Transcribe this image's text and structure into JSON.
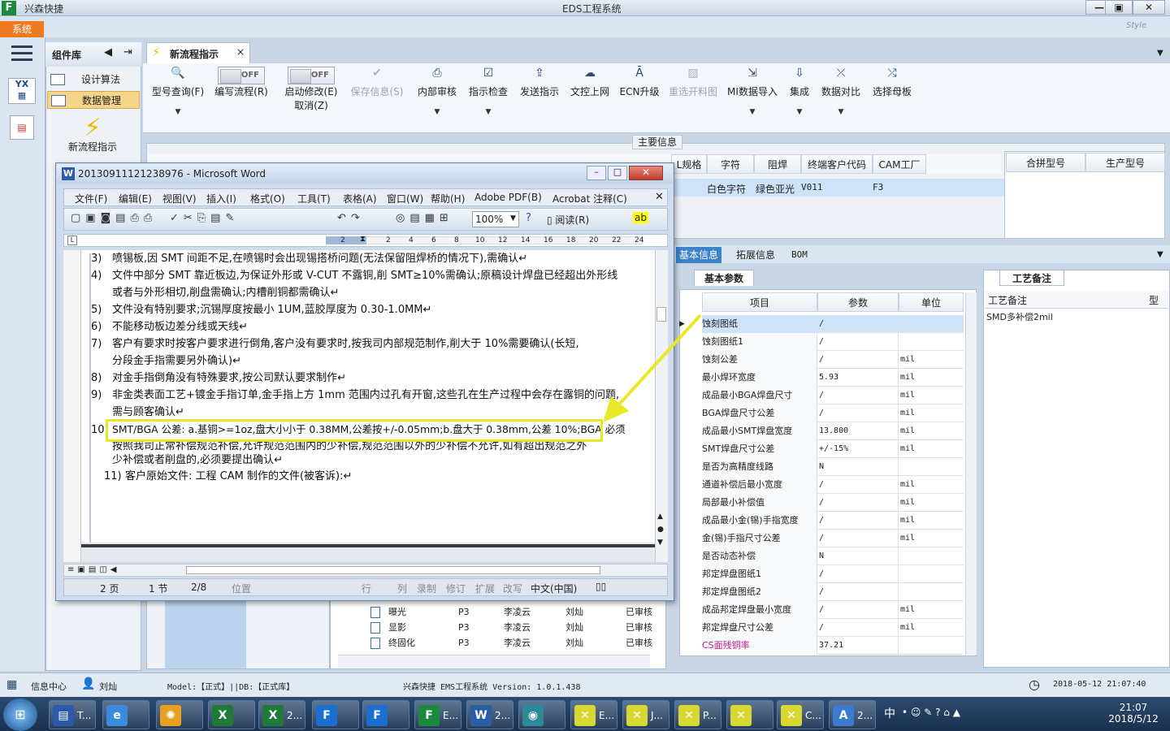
{
  "app": {
    "name": "兴森快捷",
    "window_title": "EDS工程系统",
    "style_label": "Style",
    "system_tab": "系统",
    "minimize": "—",
    "restore": "▣",
    "close": "✕"
  },
  "component_panel": {
    "title": "组件库",
    "items": [
      {
        "label": "设计算法"
      },
      {
        "label": "数据管理"
      }
    ],
    "new_flow_label": "新流程指示"
  },
  "doc_tab": {
    "label": "新流程指示",
    "close": "×"
  },
  "ribbon": {
    "buttons": [
      {
        "label": "型号查询(F)",
        "icon": "search-icon"
      },
      {
        "label": "编写流程(R)",
        "toggle": "OFF"
      },
      {
        "label": "启动修改(E)",
        "toggle": "OFF",
        "label2": "取消(Z)"
      },
      {
        "label": "保存信息(S)",
        "disabled": true
      },
      {
        "label": "内部审核"
      },
      {
        "label": "指示检查"
      },
      {
        "label": "发送指示"
      },
      {
        "label": "文控上网"
      },
      {
        "label": "ECN升级"
      },
      {
        "label": "重选开料图",
        "disabled": true
      },
      {
        "label": "MI数据导入"
      },
      {
        "label": "集成"
      },
      {
        "label": "数据对比"
      },
      {
        "label": "选择母板"
      }
    ]
  },
  "main_info": {
    "label": "主要信息",
    "headers": [
      "L规格",
      "字符",
      "阻焊",
      "终端客户代码",
      "CAM工厂"
    ],
    "row": [
      "",
      "白色字符",
      "绿色亚光",
      "V011",
      "F3"
    ],
    "right_headers": [
      "合拼型号",
      "生产型号"
    ]
  },
  "lower_tabs": [
    "基本信息",
    "拓展信息",
    "BOM"
  ],
  "basic_params": {
    "tab": "基本参数",
    "headers": [
      "项目",
      "参数",
      "单位"
    ],
    "rows": [
      [
        "蚀刻图纸",
        "/",
        ""
      ],
      [
        "蚀刻图纸1",
        "/",
        ""
      ],
      [
        "蚀刻公差",
        "/",
        "mil"
      ],
      [
        "最小焊环宽度",
        "5.93",
        "mil"
      ],
      [
        "成品最小BGA焊盘尺寸",
        "/",
        "mil"
      ],
      [
        "BGA焊盘尺寸公差",
        "/",
        "mil"
      ],
      [
        "成品最小SMT焊盘宽度",
        "13.800",
        "mil"
      ],
      [
        "SMT焊盘尺寸公差",
        "+/-15%",
        "mil"
      ],
      [
        "是否为高精度线路",
        "N",
        ""
      ],
      [
        "通道补偿后最小宽度",
        "/",
        "mil"
      ],
      [
        "局部最小补偿值",
        "/",
        "mil"
      ],
      [
        "成品最小金(锡)手指宽度",
        "/",
        "mil"
      ],
      [
        "金(锡)手指尺寸公差",
        "/",
        "mil"
      ],
      [
        "是否动态补偿",
        "N",
        ""
      ],
      [
        "邦定焊盘图纸1",
        "/",
        ""
      ],
      [
        "邦定焊盘图纸2",
        "/",
        ""
      ],
      [
        "成品邦定焊盘最小宽度",
        "/",
        "mil"
      ],
      [
        "邦定焊盘尺寸公差",
        "/",
        "mil"
      ],
      [
        "CS面残铜率",
        "37.21",
        ""
      ]
    ]
  },
  "process_notes": {
    "tab": "工艺备注",
    "header": "工艺备注",
    "header2": "型",
    "note": "SMD多补偿2mil"
  },
  "tree": {
    "rows": [
      {
        "name": "曝光",
        "f": "P3",
        "p1": "李凌云",
        "p2": "刘灿",
        "s": "已审核"
      },
      {
        "name": "显影",
        "f": "P3",
        "p1": "李凌云",
        "p2": "刘灿",
        "s": "已审核"
      },
      {
        "name": "终固化",
        "f": "P3",
        "p1": "李凌云",
        "p2": "刘灿",
        "s": "已审核"
      }
    ]
  },
  "statusbar": {
    "info_center": "信息中心",
    "user": "刘灿",
    "model": "Model:【正式】||DB:【正式库】",
    "version": "兴森快捷 EMS工程系统 Version: 1.0.1.438",
    "datetime": "2018-05-12 21:07:40"
  },
  "word": {
    "title": "20130911121238976 - Microsoft Word",
    "menu": [
      "文件(F)",
      "编辑(E)",
      "视图(V)",
      "插入(I)",
      "格式(O)",
      "工具(T)",
      "表格(A)",
      "窗口(W)",
      "帮助(H)",
      "Adobe PDF(B)",
      "Acrobat 注释(C)"
    ],
    "zoom": "100%",
    "read_label": "阅读(R)",
    "ruler": [
      "2",
      "2",
      "4",
      "6",
      "8",
      "10",
      "12",
      "14",
      "16",
      "18",
      "20",
      "22",
      "24"
    ],
    "lines": [
      {
        "n": "3)",
        "t": "喷锡板,因 SMT 间距不足,在喷锡时会出现锡搭桥问题(无法保留阻焊桥的情况下),需确认↵"
      },
      {
        "n": "4)",
        "t": "文件中部分 SMT 靠近板边,为保证外形或 V-CUT 不露铜,削 SMT≥10%需确认;原稿设计焊盘已经超出外形线"
      },
      {
        "n": "",
        "t": "或者与外形相切,削盘需确认;内槽削铜都需确认↵"
      },
      {
        "n": "5)",
        "t": "文件没有特别要求;沉锡厚度按最小 1UM,蓝胶厚度为 0.30-1.0MM↵"
      },
      {
        "n": "6)",
        "t": "不能移动板边差分线或天线↵"
      },
      {
        "n": "7)",
        "t": "客户有要求时按客户要求进行倒角,客户没有要求时,按我司内部规范制作,削大于 10%需要确认(长短,"
      },
      {
        "n": "",
        "t": "分段金手指需要另外确认)↵"
      },
      {
        "n": "8)",
        "t": "对金手指倒角没有特殊要求,按公司默认要求制作↵"
      },
      {
        "n": "9)",
        "t": "非金类表面工艺+镀金手指订单,金手指上方 1mm 范围内过孔有开窗,这些孔在生产过程中会存在露铜的问题,"
      },
      {
        "n": "",
        "t": "需与顾客确认↵"
      },
      {
        "n": "10)",
        "t": "SMT/BGA 公差: a.基铜>=1oz,盘大小小于 0.38MM,公差按+/-0.05mm;b.盘大于 0.38mm,公差 10%;BGA 必须"
      },
      {
        "n": "",
        "t": "按照我司正常补偿规范补偿,允许规范范围内的少补偿,规范范围以外的少补偿不允许,如有超出规范之外"
      },
      {
        "n": "",
        "t": "少补偿或者削盘的,必须要提出确认↵"
      },
      {
        "n": "11)",
        "t": "客户原始文件:          工程 CAM 制作的文件(被客诉):↵"
      }
    ],
    "status": [
      "2 页",
      "1 节",
      "2/8",
      "位置",
      "行",
      "列",
      "录制",
      "修订",
      "扩展",
      "改写",
      "中文(中国)"
    ]
  },
  "taskbar": {
    "time": "21:07",
    "date": "2018/5/12",
    "items": [
      {
        "label": "T..."
      },
      {
        "label": ""
      },
      {
        "label": ""
      },
      {
        "label": ""
      },
      {
        "label": "2..."
      },
      {
        "label": ""
      },
      {
        "label": ""
      },
      {
        "label": "E..."
      },
      {
        "label": "2..."
      },
      {
        "label": ""
      },
      {
        "label": "E..."
      },
      {
        "label": "J..."
      },
      {
        "label": "P..."
      },
      {
        "label": ""
      },
      {
        "label": "C..."
      },
      {
        "label": "2..."
      }
    ],
    "ime": "中"
  },
  "colors": {
    "accent": "#3b82c8",
    "system_tab": "#f07a22",
    "highlight": "#e8e826",
    "excel": "#1f7a3a"
  }
}
